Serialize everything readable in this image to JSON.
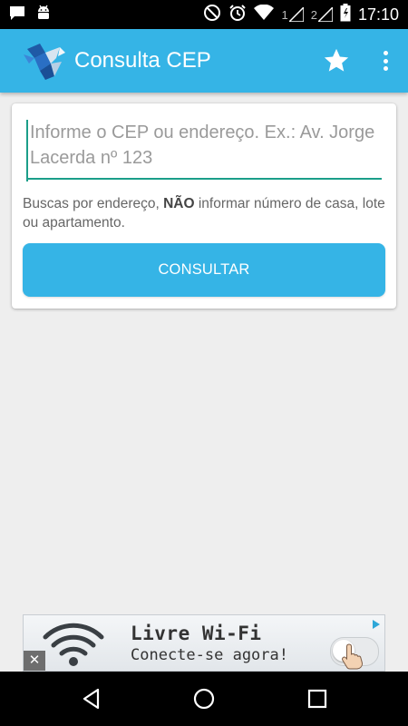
{
  "status_bar": {
    "time": "17:10",
    "sim1": "1",
    "sim2": "2",
    "icons": [
      "notification-message-icon",
      "android-icon",
      "do-not-disturb-icon",
      "alarm-icon",
      "wifi-icon",
      "signal-icon",
      "battery-icon"
    ]
  },
  "app_bar": {
    "title": "Consulta CEP",
    "logo_icon": "bird-logo-icon",
    "favorite_icon": "star-icon",
    "menu_icon": "more-vert-icon",
    "color": "#35b4e6"
  },
  "search": {
    "placeholder": "Informe o CEP ou endereço. Ex.: Av. Jorge Lacerda nº 123",
    "value": "",
    "hint_prefix": "Buscas por endereço, ",
    "hint_bold": "NÃO",
    "hint_suffix": " informar número de casa, lote ou apartamento.",
    "button_label": "CONSULTAR",
    "accent_color": "#1b9e89"
  },
  "ad": {
    "title": "Livre Wi-Fi",
    "subtitle": "Conecte-se agora!",
    "close_label": "✕",
    "icons": [
      "wifi-icon",
      "toggle-icon",
      "hand-pointer-icon",
      "ad-choices-icon"
    ]
  },
  "nav_bar": {
    "icons": [
      "back-icon",
      "home-icon",
      "recents-icon"
    ]
  }
}
